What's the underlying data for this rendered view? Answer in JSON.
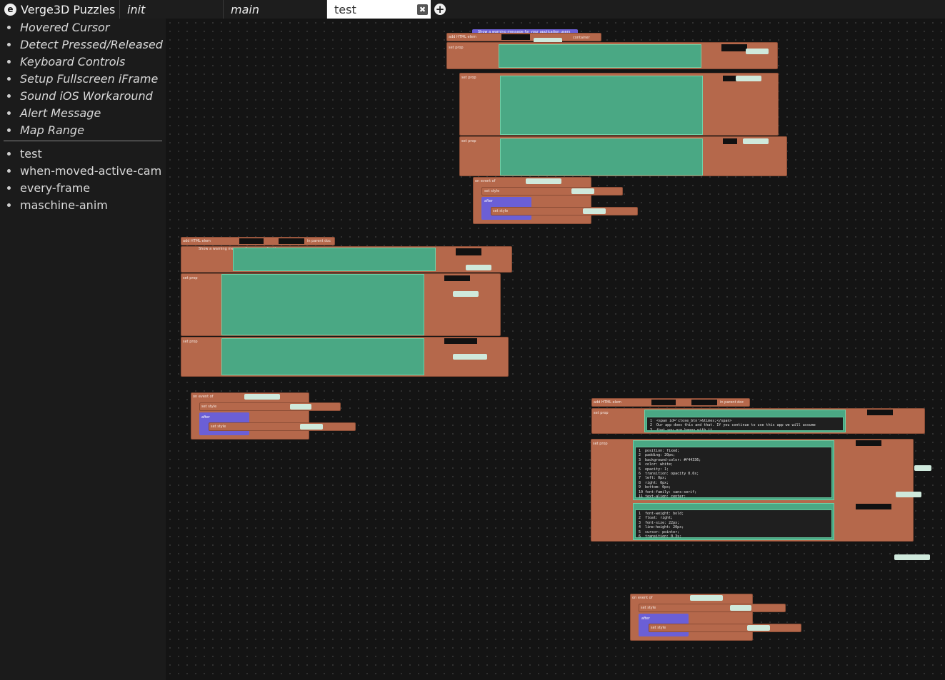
{
  "app": {
    "title": "Verge3D Puzzles"
  },
  "tabs": [
    {
      "label": "init"
    },
    {
      "label": "main"
    },
    {
      "label": "test"
    }
  ],
  "sidebar": {
    "library": [
      {
        "label": "Hovered Cursor"
      },
      {
        "label": "Detect Pressed/Released"
      },
      {
        "label": "Keyboard Controls"
      },
      {
        "label": "Setup Fullscreen iFrame"
      },
      {
        "label": "Sound iOS Workaround"
      },
      {
        "label": "Alert Message"
      },
      {
        "label": "Map Range"
      }
    ],
    "procedures": [
      {
        "label": "test"
      },
      {
        "label": "when-moved-active-cam"
      },
      {
        "label": "every-frame"
      },
      {
        "label": "maschine-anim"
      }
    ]
  },
  "blocks": {
    "comment": "Show a warning message for your application users",
    "add_html": "add HTML elem",
    "div": "div",
    "with_id": "with id",
    "to": "to",
    "in_parent_doc": "in parent doc",
    "set_prop": "set prop",
    "innerHTML": "innerHTML",
    "style": "style",
    "highlight": "highlight",
    "for_elem": "for elem",
    "alert": "alert",
    "close_btn": "close_btn",
    "on_event": "on event of",
    "click": "click",
    "set_style": "set style",
    "opacity": "opacity",
    "zero": "0",
    "after": "after",
    "after_value": "0.6",
    "seconds": "second(s)",
    "do": "do",
    "none": "none",
    "container": "container",
    "code_inner": "1  <span id='close_btn'>&times;</span>\n2  Our app does this and that. If you continue to use this app we will assume\n3  that you are happy with it.",
    "code_style1": "1  position: fixed;\n2  padding: 20px;\n3  background-color: #f44336;\n4  color: white;\n5  opacity: 1;\n6  transition: opacity 0.6s;\n7  left: 0px;\n8  right: 0px;\n9  bottom: 0px;\n10 font-family: sans-serif;\n11 text-align: center;",
    "code_style2": "1  font-weight: bold;\n2  float: right;\n3  font-size: 22px;\n4  line-height: 20px;\n5  cursor: pointer;\n6  transition: 0.3s;"
  }
}
